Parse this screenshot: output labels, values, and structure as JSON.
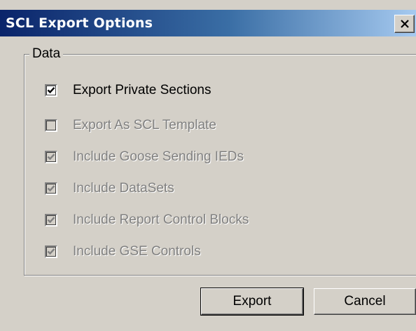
{
  "window": {
    "title": "SCL Export Options",
    "close_icon": "close-icon"
  },
  "group": {
    "label": "Data"
  },
  "options": [
    {
      "label": "Export Private Sections",
      "checked": true,
      "enabled": true
    },
    {
      "label": "Export As SCL Template",
      "checked": false,
      "enabled": false
    },
    {
      "label": "Include Goose Sending IEDs",
      "checked": true,
      "enabled": false
    },
    {
      "label": "Include DataSets",
      "checked": true,
      "enabled": false
    },
    {
      "label": "Include Report Control Blocks",
      "checked": true,
      "enabled": false
    },
    {
      "label": "Include GSE Controls",
      "checked": true,
      "enabled": false
    }
  ],
  "buttons": {
    "export_label": "Export",
    "cancel_label": "Cancel"
  },
  "colors": {
    "titlebar_start": "#0a246a",
    "titlebar_end": "#a6caf0",
    "face": "#d4d0c8",
    "disabled_text": "#808080"
  }
}
